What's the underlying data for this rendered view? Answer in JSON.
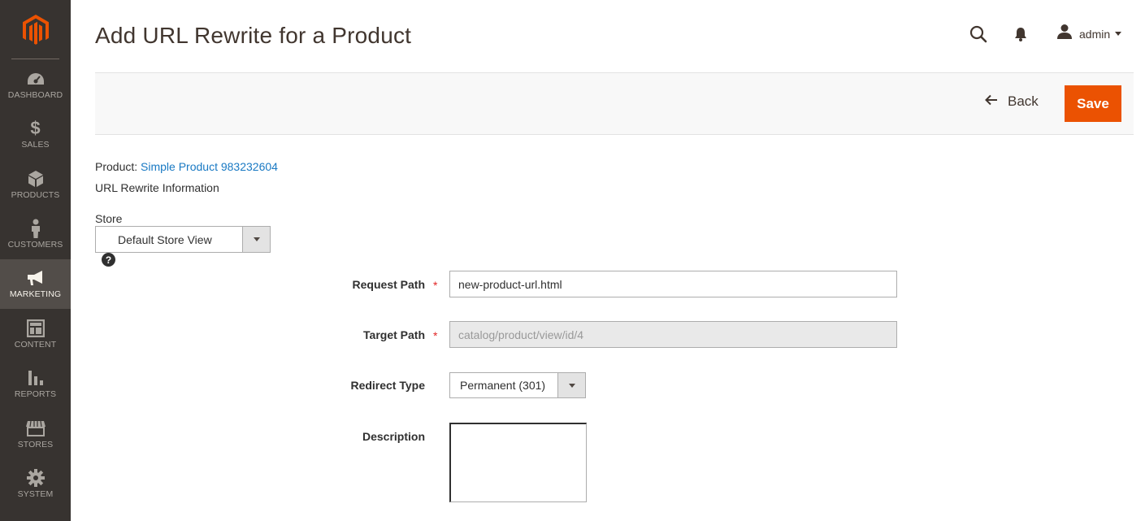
{
  "sidebar": {
    "items": [
      {
        "label": "DASHBOARD",
        "icon": "gauge-icon"
      },
      {
        "label": "SALES",
        "icon": "dollar-icon"
      },
      {
        "label": "PRODUCTS",
        "icon": "cube-icon"
      },
      {
        "label": "CUSTOMERS",
        "icon": "person-icon"
      },
      {
        "label": "MARKETING",
        "icon": "megaphone-icon",
        "active": true
      },
      {
        "label": "CONTENT",
        "icon": "layout-icon"
      },
      {
        "label": "REPORTS",
        "icon": "bar-chart-icon"
      },
      {
        "label": "STORES",
        "icon": "storefront-icon"
      },
      {
        "label": "SYSTEM",
        "icon": "gear-icon"
      }
    ]
  },
  "header": {
    "title": "Add URL Rewrite for a Product",
    "user": "admin"
  },
  "actions": {
    "back_label": "Back",
    "save_label": "Save"
  },
  "form": {
    "product_prefix": "Product:",
    "product_name": "Simple Product 983232604",
    "section_title": "URL Rewrite Information",
    "store": {
      "label": "Store",
      "value": "Default Store View"
    },
    "request_path": {
      "label": "Request Path",
      "value": "new-product-url.html",
      "required": "*"
    },
    "target_path": {
      "label": "Target Path",
      "value": "catalog/product/view/id/4",
      "required": "*"
    },
    "redirect_type": {
      "label": "Redirect Type",
      "value": "Permanent (301)"
    },
    "description": {
      "label": "Description",
      "value": ""
    }
  },
  "colors": {
    "accent": "#eb5202",
    "sidebar_bg": "#373330",
    "link": "#1979c3",
    "required": "#e22626"
  }
}
